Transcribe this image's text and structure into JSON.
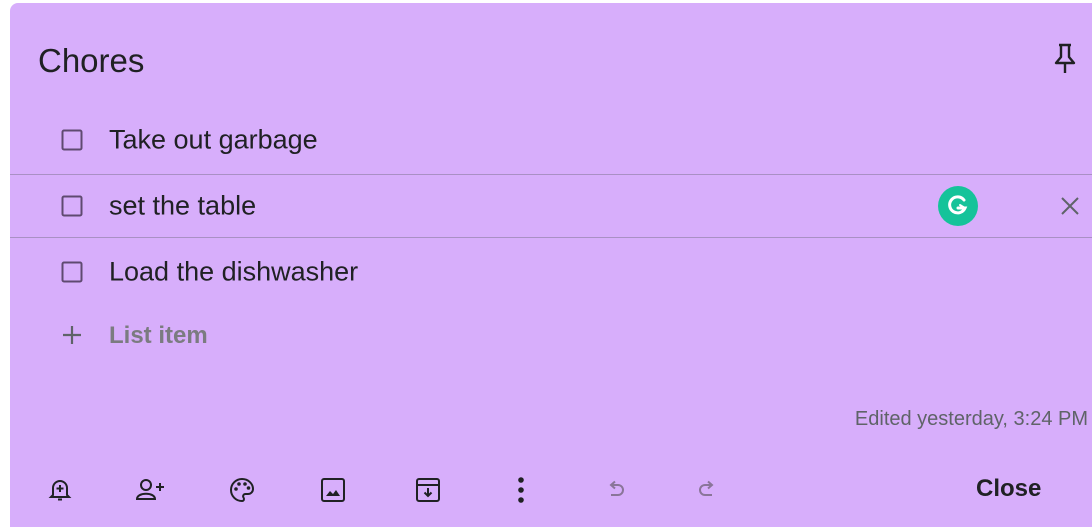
{
  "note": {
    "title": "Chores",
    "background_color": "#d7aefb",
    "pin_icon": "pin-icon",
    "items": [
      {
        "text": "Take out garbage",
        "checked": false
      },
      {
        "text": "set the table",
        "checked": false,
        "focused": true
      },
      {
        "text": "Load the dishwasher",
        "checked": false
      }
    ],
    "add_item_placeholder": "List item",
    "edited_text": "Edited yesterday, 3:24 PM",
    "grammarly_color": "#15c39a"
  },
  "toolbar": {
    "icons": [
      "remind-me-icon",
      "collaborator-icon",
      "palette-icon",
      "image-icon",
      "archive-icon",
      "more-icon",
      "undo-icon",
      "redo-icon"
    ],
    "close_label": "Close"
  }
}
